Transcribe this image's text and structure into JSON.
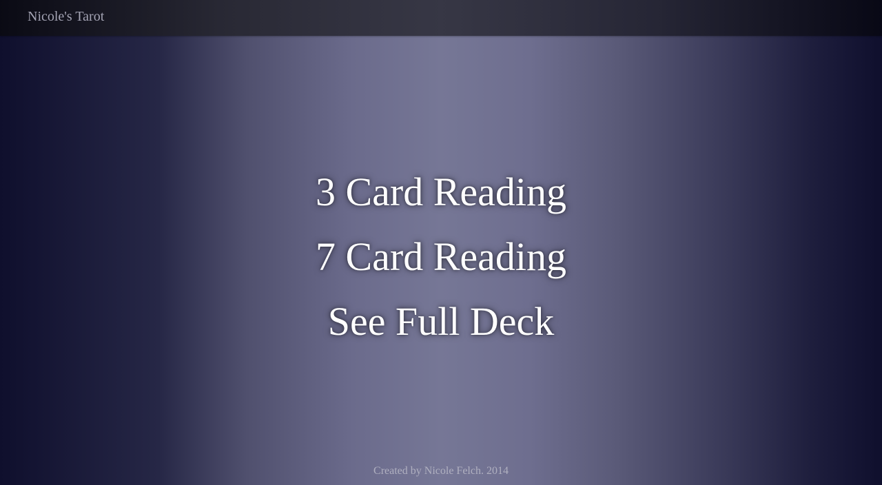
{
  "navbar": {
    "brand": "Nicole's Tarot"
  },
  "menu": {
    "items": [
      {
        "label": "3 Card Reading"
      },
      {
        "label": "7 Card Reading"
      },
      {
        "label": "See Full Deck"
      }
    ]
  },
  "footer": {
    "text": "Created by Nicole Felch. 2014"
  },
  "colors": {
    "background_center": "#767796",
    "background_edge": "#0f0f2d",
    "navbar": "#26262f",
    "menu_text": "#ffffff",
    "muted_text": "#a4a4b4"
  }
}
